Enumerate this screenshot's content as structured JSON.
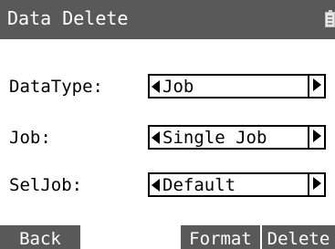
{
  "title_bar": {
    "title": "Data Delete",
    "battery_icon": "battery-icon"
  },
  "form": {
    "rows": [
      {
        "label": "DataType:",
        "value": "Job"
      },
      {
        "label": "Job:",
        "value": "Single Job"
      },
      {
        "label": "SelJob:",
        "value": "Default"
      }
    ],
    "left_arrow_icon": "triangle-left",
    "right_arrow_icon": "triangle-right"
  },
  "softkeys": {
    "back": "Back",
    "format": "Format",
    "delete": "Delete"
  },
  "colors": {
    "bar_background": "#595959",
    "bar_text": "#ffffff",
    "background": "#ffffff",
    "text": "#000000"
  }
}
